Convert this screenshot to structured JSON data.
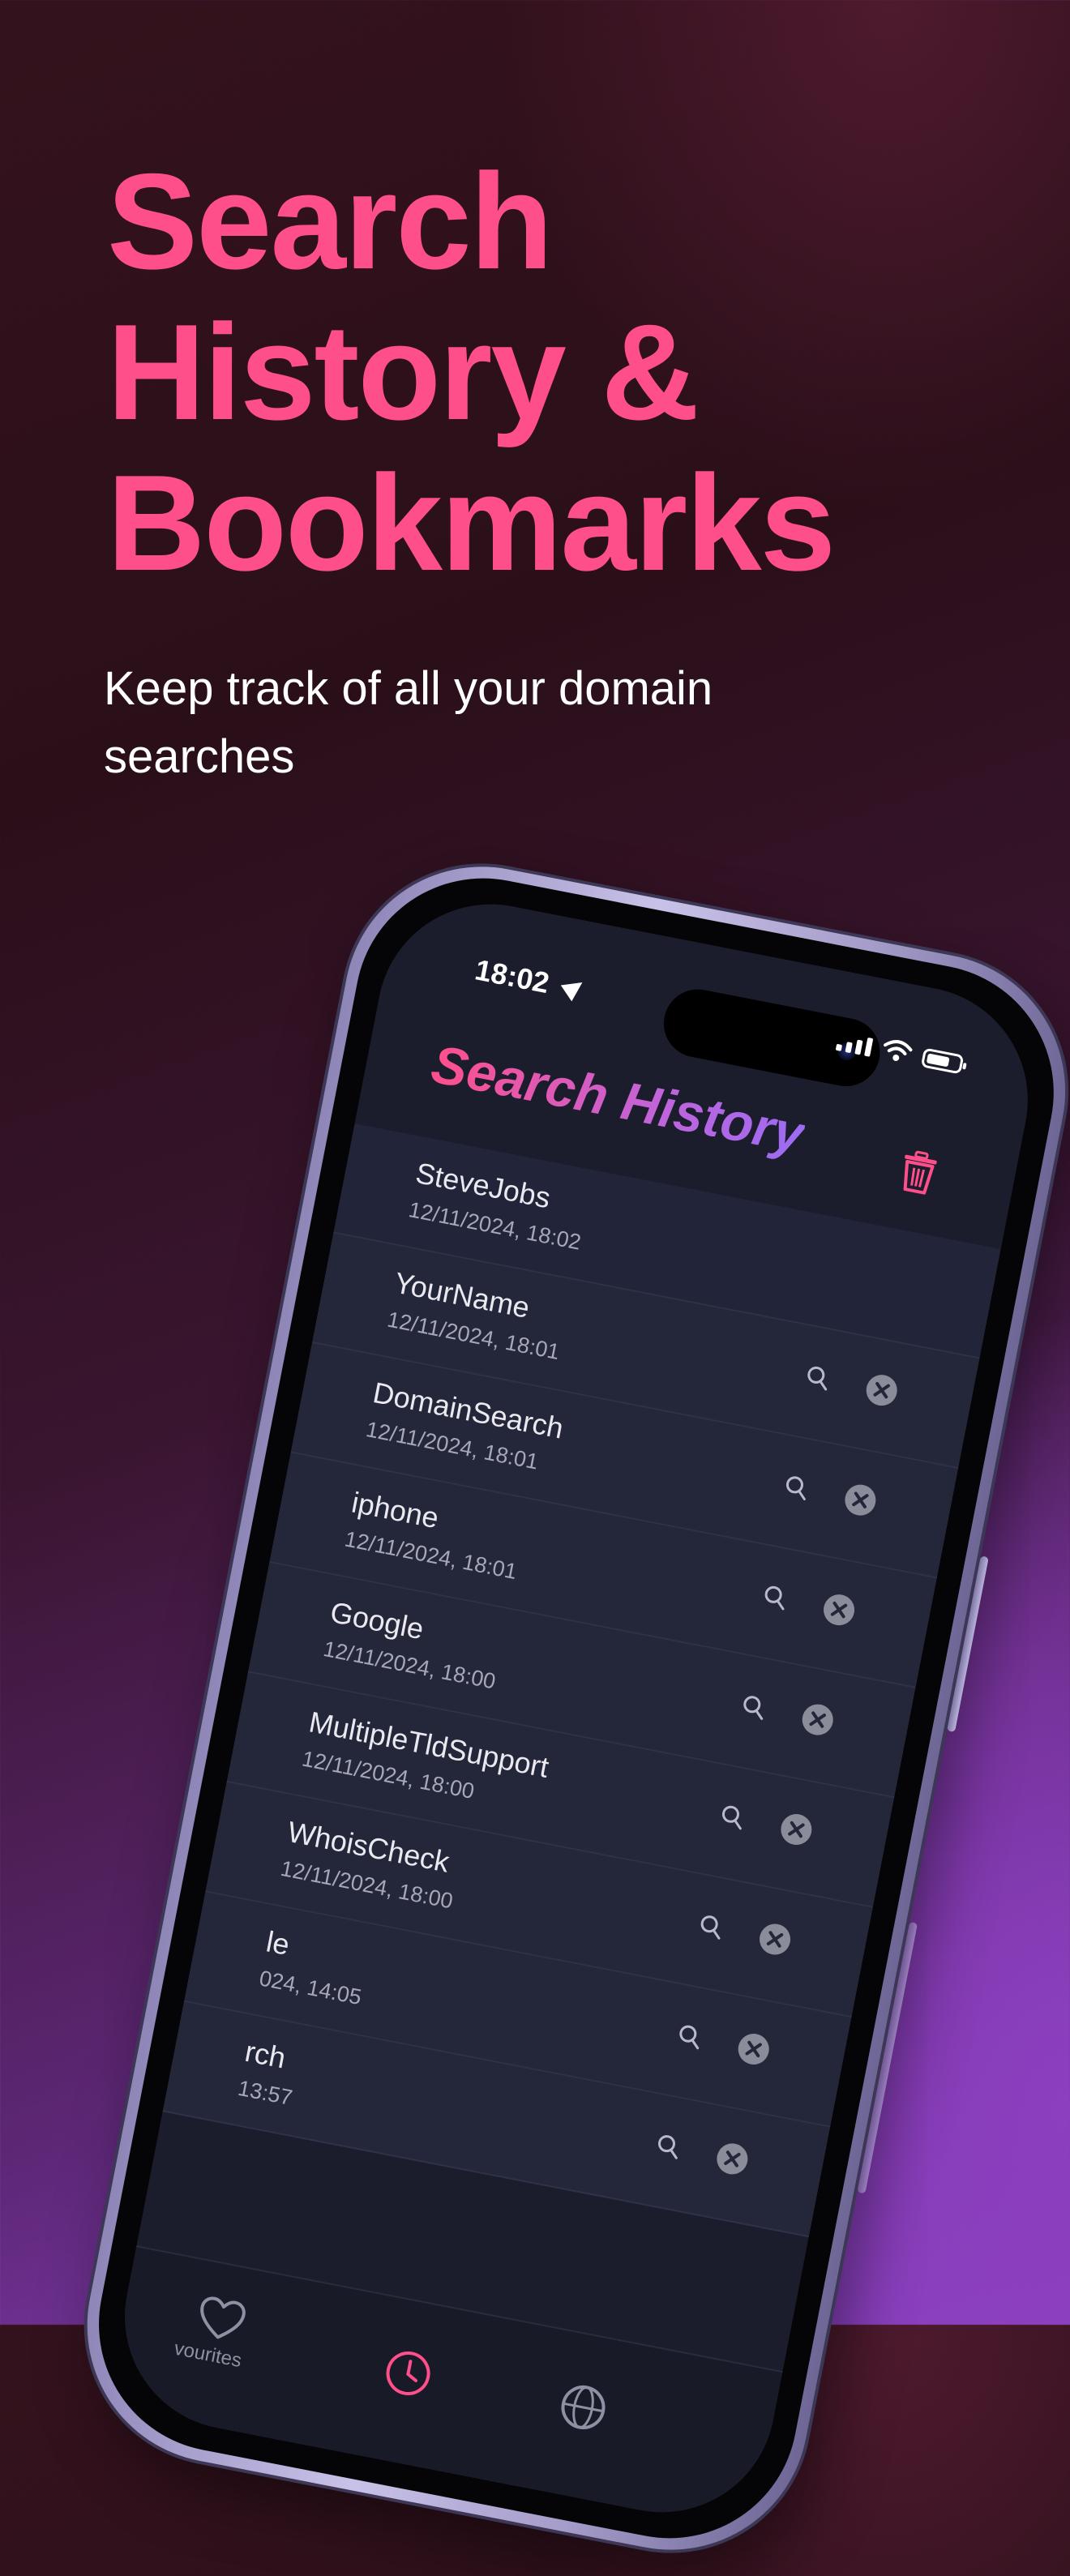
{
  "promo": {
    "headline": [
      "Search",
      "History &",
      "Bookmarks"
    ],
    "subtitle": "Keep track of all your domain searches"
  },
  "status_bar": {
    "time": "18:02"
  },
  "screen": {
    "title": "Search History",
    "items": [
      {
        "name": "SteveJobs",
        "date": "12/11/2024, 18:02"
      },
      {
        "name": "YourName",
        "date": "12/11/2024, 18:01"
      },
      {
        "name": "DomainSearch",
        "date": "12/11/2024, 18:01"
      },
      {
        "name": "iphone",
        "date": "12/11/2024, 18:01"
      },
      {
        "name": "Google",
        "date": "12/11/2024, 18:00"
      },
      {
        "name": "MultipleTldSupport",
        "date": "12/11/2024, 18:00"
      },
      {
        "name": "WhoisCheck",
        "date": "12/11/2024, 18:00"
      },
      {
        "name": "le",
        "date": "024, 14:05"
      },
      {
        "name": "rch",
        "date": "13:57"
      }
    ],
    "tabs": {
      "favourites_label": "vourites"
    }
  },
  "colors": {
    "accent_pink": "#ff4f8b",
    "accent_purple": "#9b6cf3",
    "screen_bg": "#1b1d2c",
    "row_bg": "#24273a"
  },
  "icons": {
    "trash": "trash-icon",
    "row_search": "magnifier-icon",
    "row_remove": "close-circle-icon",
    "tab_favourites": "heart-icon",
    "tab_history": "clock-icon"
  }
}
